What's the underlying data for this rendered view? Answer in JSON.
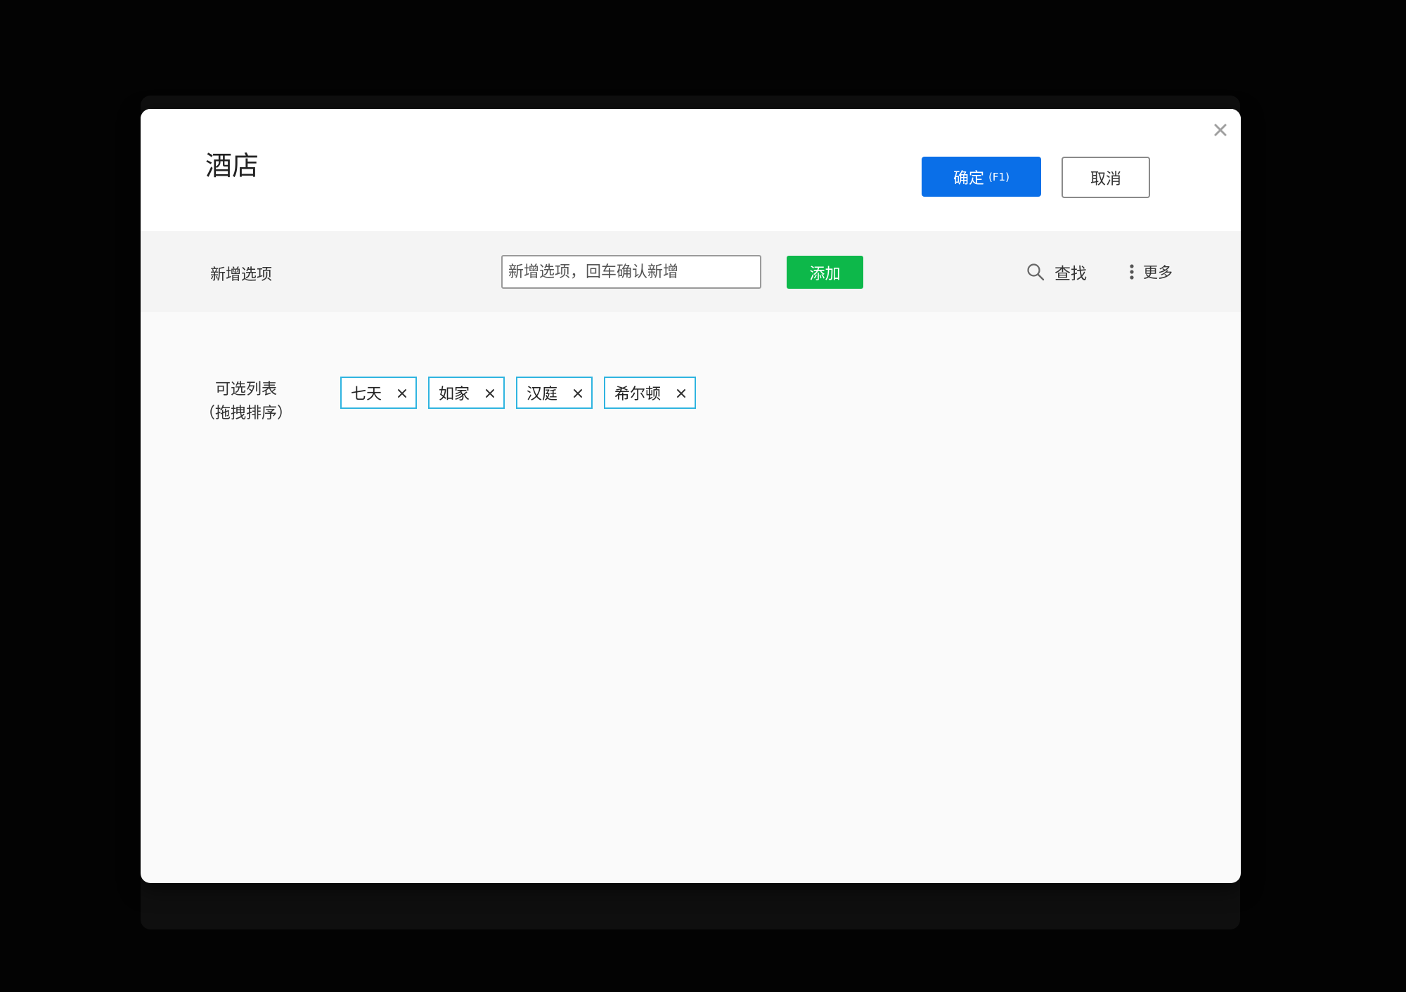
{
  "dialog": {
    "title": "酒店",
    "confirm_label": "确定",
    "confirm_hotkey": "(F1)",
    "cancel_label": "取消"
  },
  "toolbar": {
    "add_label": "新增选项",
    "input_placeholder": "新增选项，回车确认新增",
    "input_value": "",
    "add_button": "添加",
    "find_label": "查找",
    "more_label": "更多"
  },
  "list": {
    "label_line1": "可选列表",
    "label_line2": "（拖拽排序）",
    "items": [
      {
        "label": "七天"
      },
      {
        "label": "如家"
      },
      {
        "label": "汉庭"
      },
      {
        "label": "希尔顿"
      }
    ]
  },
  "colors": {
    "confirm_bg": "#0a6fe8",
    "add_bg": "#0db84a",
    "tag_border": "#2fb4e0"
  },
  "icons": {
    "close": "close-icon",
    "search": "search-icon",
    "more": "more-vertical-icon",
    "tag_remove": "remove-icon"
  }
}
